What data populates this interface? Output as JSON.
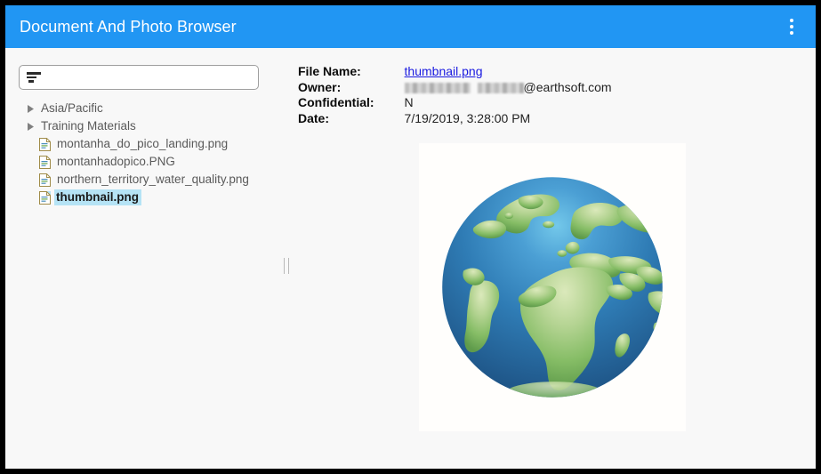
{
  "window": {
    "title": "Document And Photo Browser",
    "menu_icon": "kebab-menu-icon",
    "header_color": "#2196f3",
    "background_color": "#f8f8f8"
  },
  "left_pane": {
    "filter": {
      "icon": "filter-icon",
      "value": "",
      "placeholder": ""
    },
    "tree": {
      "items": [
        {
          "label": "Asia/Pacific",
          "type": "folder",
          "expanded": false,
          "selected": false,
          "icon": "caret-right-icon"
        },
        {
          "label": "Training Materials",
          "type": "folder",
          "expanded": false,
          "selected": false,
          "icon": "caret-right-icon"
        },
        {
          "label": "montanha_do_pico_landing.png",
          "type": "file",
          "selected": false,
          "icon": "document-icon"
        },
        {
          "label": "montanhadopico.PNG",
          "type": "file",
          "selected": false,
          "icon": "document-icon"
        },
        {
          "label": "northern_territory_water_quality.png",
          "type": "file",
          "selected": false,
          "icon": "document-icon"
        },
        {
          "label": "thumbnail.png",
          "type": "file",
          "selected": true,
          "icon": "document-icon"
        }
      ],
      "selection_color": "#b5e3f5"
    }
  },
  "splitter": {
    "icon": "vertical-grip-icon"
  },
  "right_pane": {
    "metadata": [
      {
        "label": "File Name:",
        "value": "thumbnail.png",
        "is_link": true,
        "redacted": false
      },
      {
        "label": "Owner:",
        "value": "@earthsoft.com",
        "is_link": false,
        "redacted": true
      },
      {
        "label": "Confidential:",
        "value": "N",
        "is_link": false,
        "redacted": false
      },
      {
        "label": "Date:",
        "value": "7/19/2019, 3:28:00 PM",
        "is_link": false,
        "redacted": false
      }
    ],
    "preview": {
      "icon": "globe-image",
      "alt": "globe showing Europe, Africa and the Atlantic Ocean",
      "background_color": "#fffefc",
      "ocean_color": "#2a6ea6",
      "land_color": "#8cc06e"
    }
  }
}
